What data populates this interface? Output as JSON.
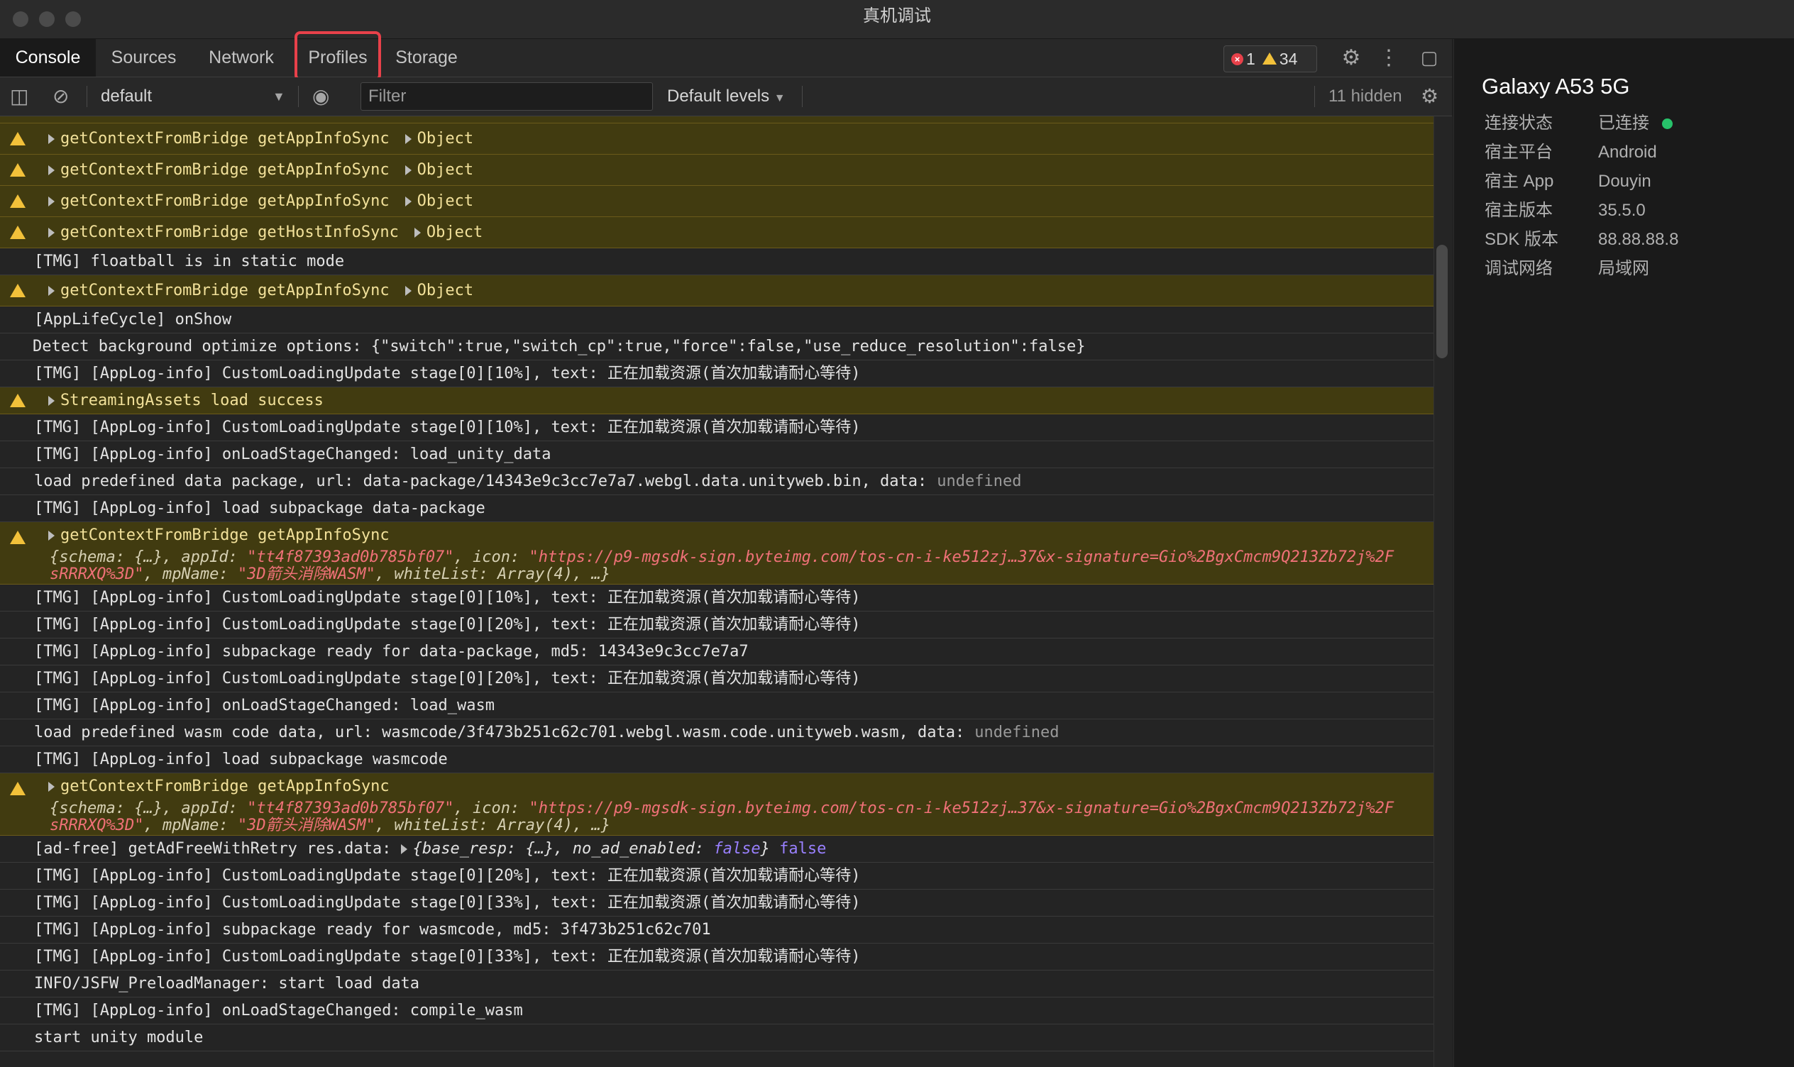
{
  "window": {
    "title": "真机调试"
  },
  "tabs": [
    {
      "label": "Console"
    },
    {
      "label": "Sources"
    },
    {
      "label": "Network"
    },
    {
      "label": "Profiles"
    },
    {
      "label": "Storage"
    }
  ],
  "toolbar": {
    "error_count": "1",
    "warning_count": "34"
  },
  "filter": {
    "context": "default",
    "placeholder": "Filter",
    "levels": "Default levels",
    "hidden": "11 hidden"
  },
  "console": {
    "rows": [
      {
        "text": "getContextFromBridge getAppInfoSync",
        "obj": "Object"
      },
      {
        "text": "getContextFromBridge getAppInfoSync",
        "obj": "Object"
      },
      {
        "text": "getContextFromBridge getAppInfoSync",
        "obj": "Object"
      },
      {
        "text": "getContextFromBridge getHostInfoSync",
        "obj": "Object"
      },
      {
        "text": "[TMG] floatball is in static mode"
      },
      {
        "text": "getContextFromBridge getAppInfoSync",
        "obj": "Object"
      },
      {
        "text": "[AppLifeCycle] onShow"
      },
      {
        "text": "Detect background optimize options: {\"switch\":true,\"switch_cp\":true,\"force\":false,\"use_reduce_resolution\":false}"
      },
      {
        "text": "[TMG] [AppLog-info] CustomLoadingUpdate stage[0][10%], text: 正在加载资源(首次加载请耐心等待)"
      },
      {
        "text": "StreamingAssets load success"
      },
      {
        "text": "[TMG] [AppLog-info] CustomLoadingUpdate stage[0][10%], text: 正在加载资源(首次加载请耐心等待)"
      },
      {
        "text": "[TMG] [AppLog-info] onLoadStageChanged: load_unity_data"
      },
      {
        "text": "load predefined data package, url: data-package/14343e9c3cc7e7a7.webgl.data.unityweb.bin, data:",
        "undef": "undefined"
      },
      {
        "text": "[TMG] [AppLog-info] load subpackage data-package"
      },
      {
        "text": "getContextFromBridge getAppInfoSync",
        "schema": "{schema: {…}, appId: ",
        "appid": "\"tt4f87393ad0b785bf07\"",
        "icon_key": ", icon: ",
        "icon": "\"https://p9-mgsdk-sign.byteimg.com/tos-cn-i-ke512zj…37&x-signature=Gio%2BgxCmcm9Q213Zb72j%2F",
        "icon_tail": "sRRRXQ%3D\"",
        "mp_key": ", mpName: ",
        "mp": "\"3D箭头消除WASM\"",
        "wl": ", whiteList: Array(4), …}"
      },
      {
        "text": "[TMG] [AppLog-info] CustomLoadingUpdate stage[0][10%], text: 正在加载资源(首次加载请耐心等待)"
      },
      {
        "text": "[TMG] [AppLog-info] CustomLoadingUpdate stage[0][20%], text: 正在加载资源(首次加载请耐心等待)"
      },
      {
        "text": "[TMG] [AppLog-info] subpackage ready for data-package, md5: 14343e9c3cc7e7a7"
      },
      {
        "text": "[TMG] [AppLog-info] CustomLoadingUpdate stage[0][20%], text: 正在加载资源(首次加载请耐心等待)"
      },
      {
        "text": "[TMG] [AppLog-info] onLoadStageChanged: load_wasm"
      },
      {
        "text": "load predefined wasm code data, url: wasmcode/3f473b251c62c701.webgl.wasm.code.unityweb.wasm, data:",
        "undef": "undefined"
      },
      {
        "text": "[TMG] [AppLog-info] load subpackage wasmcode"
      },
      {
        "text": "getContextFromBridge getAppInfoSync",
        "schema": "{schema: {…}, appId: ",
        "appid": "\"tt4f87393ad0b785bf07\"",
        "icon_key": ", icon: ",
        "icon": "\"https://p9-mgsdk-sign.byteimg.com/tos-cn-i-ke512zj…37&x-signature=Gio%2BgxCmcm9Q213Zb72j%2F",
        "icon_tail": "sRRRXQ%3D\"",
        "mp_key": ", mpName: ",
        "mp": "\"3D箭头消除WASM\"",
        "wl": ", whiteList: Array(4), …}"
      },
      {
        "text": "[ad-free] getAdFreeWithRetry res.data:",
        "resp": "{base_resp: {…}, no_ad_enabled: ",
        "bool1": "false",
        "close": "}",
        "bool2": "false"
      },
      {
        "text": "[TMG] [AppLog-info] CustomLoadingUpdate stage[0][20%], text: 正在加载资源(首次加载请耐心等待)"
      },
      {
        "text": "[TMG] [AppLog-info] CustomLoadingUpdate stage[0][33%], text: 正在加载资源(首次加载请耐心等待)"
      },
      {
        "text": "[TMG] [AppLog-info] subpackage ready for wasmcode, md5: 3f473b251c62c701"
      },
      {
        "text": "[TMG] [AppLog-info] CustomLoadingUpdate stage[0][33%], text: 正在加载资源(首次加载请耐心等待)"
      },
      {
        "text": "INFO/JSFW_PreloadManager: start load data"
      },
      {
        "text": "[TMG] [AppLog-info] onLoadStageChanged: compile_wasm"
      },
      {
        "text": "start unity module"
      }
    ]
  },
  "device": {
    "name": "Galaxy A53 5G",
    "fields": [
      {
        "key": "连接状态",
        "value": "已连接"
      },
      {
        "key": "宿主平台",
        "value": "Android"
      },
      {
        "key": "宿主 App",
        "value": "Douyin"
      },
      {
        "key": "宿主版本",
        "value": "35.5.0"
      },
      {
        "key": "SDK 版本",
        "value": "88.88.88.8"
      },
      {
        "key": "调试网络",
        "value": "局域网"
      }
    ]
  }
}
